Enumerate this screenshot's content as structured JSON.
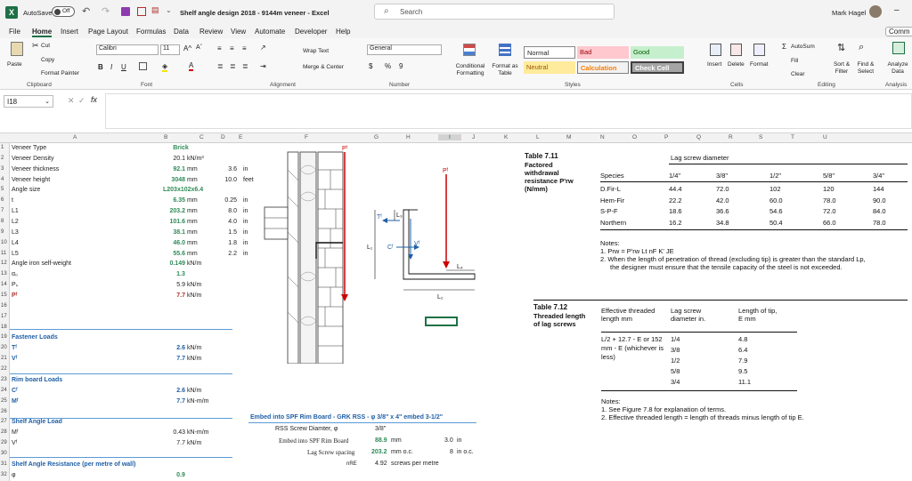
{
  "titlebar": {
    "autosave": "AutoSave",
    "toggle": "Off",
    "doc_title": "Shelf angle design 2018 - 9144m veneer  -  Excel",
    "search": "Search",
    "user": "Mark Hagel"
  },
  "menu": [
    "File",
    "Home",
    "Insert",
    "Page Layout",
    "Formulas",
    "Data",
    "Review",
    "View",
    "Automate",
    "Developer",
    "Help"
  ],
  "comments": "Comm",
  "ribbon": {
    "paste": "Paste",
    "cut": "Cut",
    "copy": "Copy",
    "format_painter": "Format Painter",
    "clipboard": "Clipboard",
    "font_name": "Calibri",
    "font_size": "11",
    "font": "Font",
    "wrap": "Wrap Text",
    "merge": "Merge & Center",
    "alignment": "Alignment",
    "numfmt": "General",
    "number": "Number",
    "cond": "Conditional Formatting",
    "fmt_table": "Format as Table",
    "normal": "Normal",
    "bad": "Bad",
    "good": "Good",
    "neutral": "Neutral",
    "calculation": "Calculation",
    "check": "Check Cell",
    "styles": "Styles",
    "insert": "Insert",
    "delete": "Delete",
    "format": "Format",
    "cells": "Cells",
    "autosum": "AutoSum",
    "fill": "Fill",
    "clear": "Clear",
    "sort": "Sort & Filter",
    "find": "Find & Select",
    "editing": "Editing",
    "analyze": "Analyze Data",
    "analysis": "Analysis"
  },
  "namebox": "I18",
  "columns": [
    "A",
    "B",
    "C",
    "D",
    "E",
    "F",
    "G",
    "H",
    "I",
    "J",
    "K",
    "L",
    "M",
    "N",
    "O",
    "P",
    "Q",
    "R",
    "S",
    "T",
    "U"
  ],
  "rows": [
    {
      "n": "1",
      "a": "Veneer Type",
      "b": "Brick",
      "c": "",
      "d": "",
      "e": ""
    },
    {
      "n": "2",
      "a": "Veneer Density",
      "b": "20.1",
      "c": "kN/m³",
      "d": "",
      "e": ""
    },
    {
      "n": "3",
      "a": "Veneer thickness",
      "b": "92.1",
      "c": "mm",
      "d": "3.6",
      "e": "in"
    },
    {
      "n": "4",
      "a": "Veneer height",
      "b": "3048",
      "c": "mm",
      "d": "10.0",
      "e": "feet"
    },
    {
      "n": "5",
      "a": "Angle size",
      "b": "L203x102x6.4",
      "c": "",
      "d": "",
      "e": ""
    },
    {
      "n": "6",
      "a": "t",
      "b": "6.35",
      "c": "mm",
      "d": "0.25",
      "e": "in"
    },
    {
      "n": "7",
      "a": "L1",
      "b": "203.2",
      "c": "mm",
      "d": "8.0",
      "e": "in"
    },
    {
      "n": "8",
      "a": "L2",
      "b": "101.6",
      "c": "mm",
      "d": "4.0",
      "e": "in"
    },
    {
      "n": "9",
      "a": "L3",
      "b": "38.1",
      "c": "mm",
      "d": "1.5",
      "e": "in"
    },
    {
      "n": "10",
      "a": "L4",
      "b": "46.0",
      "c": "mm",
      "d": "1.8",
      "e": "in"
    },
    {
      "n": "11",
      "a": "L5",
      "b": "55.6",
      "c": "mm",
      "d": "2.2",
      "e": "in"
    },
    {
      "n": "12",
      "a": "Angle iron self-weight",
      "b": "0.149",
      "c": "kN/m",
      "d": "",
      "e": ""
    },
    {
      "n": "13",
      "a": "α₀",
      "b": "1.3",
      "c": "",
      "d": "",
      "e": ""
    },
    {
      "n": "14",
      "a": "Pₛ",
      "b": "5.9",
      "c": "kN/m",
      "d": "",
      "e": ""
    },
    {
      "n": "15",
      "a": "Pᶠ",
      "b": "7.7",
      "c": "kN/m",
      "d": "",
      "e": ""
    },
    {
      "n": "16",
      "a": "",
      "b": "",
      "c": "",
      "d": "",
      "e": ""
    },
    {
      "n": "17",
      "a": "",
      "b": "",
      "c": "",
      "d": "",
      "e": ""
    },
    {
      "n": "18",
      "a": "",
      "b": "",
      "c": "",
      "d": "",
      "e": ""
    },
    {
      "n": "19",
      "a": "Fastener Loads",
      "b": "",
      "c": "",
      "d": "",
      "e": ""
    },
    {
      "n": "20",
      "a": "Tᶠ",
      "b": "2.6",
      "c": "kN/m",
      "d": "",
      "e": ""
    },
    {
      "n": "21",
      "a": "Vᶠ",
      "b": "7.7",
      "c": "kN/m",
      "d": "",
      "e": ""
    },
    {
      "n": "22",
      "a": "",
      "b": "",
      "c": "",
      "d": "",
      "e": ""
    },
    {
      "n": "23",
      "a": "Rim board Loads",
      "b": "",
      "c": "",
      "d": "",
      "e": ""
    },
    {
      "n": "24",
      "a": "Cᶠ",
      "b": "2.6",
      "c": "kN/m",
      "d": "",
      "e": ""
    },
    {
      "n": "25",
      "a": "Mᶠ",
      "b": "7.7",
      "c": "kN-m/m",
      "d": "",
      "e": ""
    },
    {
      "n": "26",
      "a": "",
      "b": "",
      "c": "",
      "d": "",
      "e": ""
    },
    {
      "n": "27",
      "a": "Shelf Angle Load",
      "b": "",
      "c": "",
      "d": "",
      "e": ""
    },
    {
      "n": "28",
      "a": "Mᶠ",
      "b": "0.43",
      "c": "kN-m/m",
      "d": "",
      "e": ""
    },
    {
      "n": "29",
      "a": "Vᶠ",
      "b": "7.7",
      "c": "kN/m",
      "d": "",
      "e": ""
    },
    {
      "n": "30",
      "a": "",
      "b": "",
      "c": "",
      "d": "",
      "e": ""
    },
    {
      "n": "31",
      "a": "Shelf Angle Resistance (per metre of wall)",
      "b": "",
      "c": "",
      "d": "",
      "e": ""
    },
    {
      "n": "32",
      "a": "φ",
      "b": "0.9",
      "c": "",
      "d": "",
      "e": ""
    }
  ],
  "embed": {
    "title": "Embed into SPF Rim Board - GRK RSS - φ 3/8\" x 4\" embed 3-1/2\"",
    "r1l": "RSS Screw Diamter, φ",
    "r1v": "3/8\"",
    "r2l": "Embed into SPF Rim Board",
    "r2v": "88.9",
    "r2u": "mm",
    "r2i": "3.0",
    "r2iu": "in",
    "r3l": "Lag Screw spacing",
    "r3v": "203.2",
    "r3u": "mm o.c.",
    "r3i": "8",
    "r3iu": "in o.c.",
    "r4l": "nRE",
    "r4v": "4.92",
    "r4u": "screws per metre"
  },
  "diagram": {
    "pf": "Pᶠ",
    "tf": "Tᶠ",
    "cf": "Cᶠ",
    "vf": "Vᶠ",
    "l1": "L₁",
    "l2": "L₂",
    "l3": "L₃",
    "l4": "L₄",
    "pf2": "Pᶠ"
  },
  "table711": {
    "title": "Table 7.11",
    "sub": "Factored withdrawal resistance P'rw (N/mm)",
    "hdr": "Lag screw diameter",
    "cols": [
      "Species",
      "1/4\"",
      "3/8\"",
      "1/2\"",
      "5/8\"",
      "3/4\""
    ],
    "rows": [
      [
        "D.Fir-L",
        "44.4",
        "72.0",
        "102",
        "120",
        "144"
      ],
      [
        "Hem-Fir",
        "22.2",
        "42.0",
        "60.0",
        "78.0",
        "90.0"
      ],
      [
        "S-P-F",
        "18.6",
        "36.6",
        "54.6",
        "72.0",
        "84.0"
      ],
      [
        "Northern",
        "16.2",
        "34.8",
        "50.4",
        "66.0",
        "78.0"
      ]
    ],
    "notes": "Notes:",
    "n1": "1.  Prw = P'rw Lt nF K' JE",
    "n2": "2.  When the length of penetration of thread (excluding tip) is greater than the standard Lp,",
    "n3": "the designer must ensure that the tensile capacity of the steel is not exceeded."
  },
  "table712": {
    "title": "Table 7.12",
    "sub": "Threaded length of lag screws",
    "h1": "Effective threaded length mm",
    "h2": "Lag screw diameter in.",
    "h3": "Length of tip, E mm",
    "rows": [
      [
        "1/4",
        "4.8"
      ],
      [
        "3/8",
        "6.4"
      ],
      [
        "1/2",
        "7.9"
      ],
      [
        "5/8",
        "9.5"
      ],
      [
        "3/4",
        "11.1"
      ]
    ],
    "eq": "L/2 + 12.7 - E  or  152 mm - E (whichever is less)",
    "notes": "Notes:",
    "n1": "1.  See Figure 7.8 for explanation of terms.",
    "n2": "2.  Effective threaded length = length of threads minus length of tip E."
  }
}
